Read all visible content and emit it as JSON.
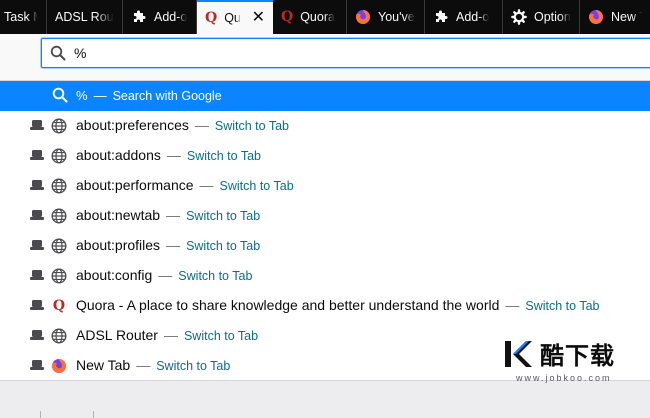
{
  "tabs": [
    {
      "label": "Task M",
      "icon": "none",
      "active": false
    },
    {
      "label": "ADSL Rout",
      "icon": "none",
      "active": false
    },
    {
      "label": "Add-o",
      "icon": "puzzle-icon",
      "active": false
    },
    {
      "label": "Qu",
      "icon": "quora-icon",
      "active": true
    },
    {
      "label": "Quora",
      "icon": "quora-icon",
      "active": false
    },
    {
      "label": "You've",
      "icon": "firefox-icon",
      "active": false
    },
    {
      "label": "Add-o",
      "icon": "puzzle-icon",
      "active": false
    },
    {
      "label": "Option",
      "icon": "gear-icon",
      "active": false
    },
    {
      "label": "New T",
      "icon": "firefox-icon",
      "active": false
    }
  ],
  "urlbar": {
    "value": "%"
  },
  "search_row": {
    "query": "%",
    "separator": "—",
    "action": "Search with Google"
  },
  "results": [
    {
      "title": "about:preferences",
      "icon": "globe-icon",
      "action": "Switch to Tab"
    },
    {
      "title": "about:addons",
      "icon": "globe-icon",
      "action": "Switch to Tab"
    },
    {
      "title": "about:performance",
      "icon": "globe-icon",
      "action": "Switch to Tab"
    },
    {
      "title": "about:newtab",
      "icon": "globe-icon",
      "action": "Switch to Tab"
    },
    {
      "title": "about:profiles",
      "icon": "globe-icon",
      "action": "Switch to Tab"
    },
    {
      "title": "about:config",
      "icon": "globe-icon",
      "action": "Switch to Tab"
    },
    {
      "title": "Quora - A place to share knowledge and better understand the world",
      "icon": "quora-icon",
      "action": "Switch to Tab"
    },
    {
      "title": "ADSL Router",
      "icon": "globe-icon",
      "action": "Switch to Tab"
    },
    {
      "title": "New Tab",
      "icon": "firefox-icon",
      "action": "Switch to Tab"
    }
  ],
  "separator": "—",
  "watermark": {
    "name": "酷下载",
    "url": "www.jobkoo.com"
  },
  "colors": {
    "accent": "#0a84ff",
    "switch_to_tab": "#0a6e85",
    "quora": "#b92b27",
    "tabstrip": "#0c0c0d"
  }
}
